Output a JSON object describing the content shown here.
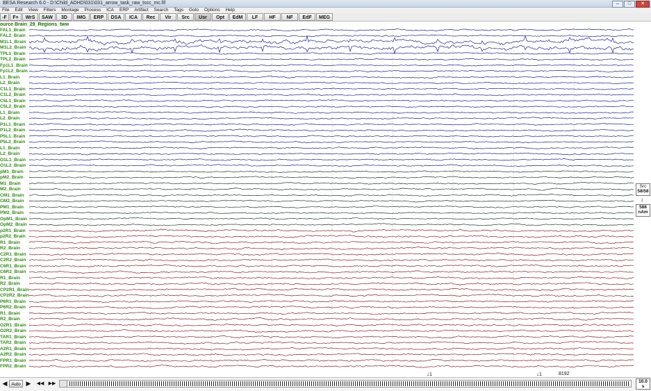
{
  "window": {
    "title": "BESA Research 6.0 - D:\\Child_ADHD\\031\\031_arrow_task_raw_tscc_mc.fif",
    "min": "–",
    "max": "□",
    "close": "✕"
  },
  "menu": [
    "File",
    "Edit",
    "View",
    "Filters",
    "Montage",
    "Process",
    "ICA",
    "ERP",
    "Artifact",
    "Search",
    "Tags",
    "Goto",
    "Options",
    "Help"
  ],
  "toolbar": [
    "-F",
    "F+",
    "WrS",
    "SAW",
    "3D",
    "IMG",
    "ERP",
    "DSA",
    "ICA",
    "Rec",
    "Vir",
    "Src",
    "Usr",
    "Opt",
    "EdM",
    "LF",
    "HF",
    "NF",
    "EdF",
    "MEG"
  ],
  "toolbar_active": "Usr",
  "montage_label": "ource Brain_29_Regions_tww",
  "channels": [
    {
      "label": "FAL1_Brain",
      "color": "#1f1f9e"
    },
    {
      "label": "FAL2_Brain",
      "color": "#1f1f9e"
    },
    {
      "label": "M1L1_Brain",
      "color": "#1f1f9e"
    },
    {
      "label": "M1L2_Brain",
      "color": "#1f1f9e"
    },
    {
      "label": "TPL1_Brain",
      "color": "#1f1f9e"
    },
    {
      "label": "TPL2_Brain",
      "color": "#1f1f9e"
    },
    {
      "label": "Fp1L1_Brain",
      "color": "#1f1f9e"
    },
    {
      "label": "Fp1L2_Brain",
      "color": "#1f1f9e"
    },
    {
      "label": "L1_Brain",
      "color": "#1f1f9e"
    },
    {
      "label": "L2_Brain",
      "color": "#1f1f9e"
    },
    {
      "label": "C1L1_Brain",
      "color": "#1f1f9e"
    },
    {
      "label": "C1L2_Brain",
      "color": "#1f1f9e"
    },
    {
      "label": "C5L1_Brain",
      "color": "#1f1f9e"
    },
    {
      "label": "C5L2_Brain",
      "color": "#1f1f9e"
    },
    {
      "label": "L1_Brain",
      "color": "#1f1f9e"
    },
    {
      "label": "L2_Brain",
      "color": "#1f1f9e"
    },
    {
      "label": "P1L1_Brain",
      "color": "#1f1f9e"
    },
    {
      "label": "P1L2_Brain",
      "color": "#1f1f9e"
    },
    {
      "label": "P5L1_Brain",
      "color": "#1f1f9e"
    },
    {
      "label": "P5L2_Brain",
      "color": "#1f1f9e"
    },
    {
      "label": "L1_Brain",
      "color": "#1f1f9e"
    },
    {
      "label": "L2_Brain",
      "color": "#1f1f9e"
    },
    {
      "label": "O1L1_Brain",
      "color": "#1f1f9e"
    },
    {
      "label": "O1L2_Brain",
      "color": "#1f1f9e"
    },
    {
      "label": "pM1_Brain",
      "color": "#1e3a2e"
    },
    {
      "label": "pM2_Brain",
      "color": "#1e3a2e"
    },
    {
      "label": "M1_Brain",
      "color": "#1e3a2e"
    },
    {
      "label": "M2_Brain",
      "color": "#1e3a2e"
    },
    {
      "label": "CM1_Brain",
      "color": "#1e3a2e"
    },
    {
      "label": "CM2_Brain",
      "color": "#1e3a2e"
    },
    {
      "label": "PM1_Brain",
      "color": "#1e3a2e"
    },
    {
      "label": "PM2_Brain",
      "color": "#1e3a2e"
    },
    {
      "label": "OpM1_Brain",
      "color": "#1e3a2e"
    },
    {
      "label": "OpM2_Brain",
      "color": "#1e3a2e"
    },
    {
      "label": "p2R1_Brain",
      "color": "#8a1f2a"
    },
    {
      "label": "p2R2_Brain",
      "color": "#8a1f2a"
    },
    {
      "label": "R1_Brain",
      "color": "#8a1f2a"
    },
    {
      "label": "R2_Brain",
      "color": "#8a1f2a"
    },
    {
      "label": "C2R1_Brain",
      "color": "#8a1f2a"
    },
    {
      "label": "C2R2_Brain",
      "color": "#8a1f2a"
    },
    {
      "label": "C6R1_Brain",
      "color": "#8a1f2a"
    },
    {
      "label": "C6R2_Brain",
      "color": "#8a1f2a"
    },
    {
      "label": "R1_Brain",
      "color": "#8a1f2a"
    },
    {
      "label": "R2_Brain",
      "color": "#8a1f2a"
    },
    {
      "label": "CP2R1_Brain",
      "color": "#8a1f2a"
    },
    {
      "label": "CP2R2_Brain",
      "color": "#8a1f2a"
    },
    {
      "label": "P6R1_Brain",
      "color": "#8a1f2a"
    },
    {
      "label": "P6R2_Brain",
      "color": "#8a1f2a"
    },
    {
      "label": "R1_Brain",
      "color": "#8a1f2a"
    },
    {
      "label": "R2_Brain",
      "color": "#8a1f2a"
    },
    {
      "label": "O2R1_Brain",
      "color": "#8a1f2a"
    },
    {
      "label": "O2R2_Brain",
      "color": "#8a1f2a"
    },
    {
      "label": "TAR1_Brain",
      "color": "#8a1f2a"
    },
    {
      "label": "TAR2_Brain",
      "color": "#8a1f2a"
    },
    {
      "label": "A2R1_Brain",
      "color": "#8a1f2a"
    },
    {
      "label": "A2R2_Brain",
      "color": "#8a1f2a"
    },
    {
      "label": "FPR1_Brain",
      "color": "#8a1f2a"
    },
    {
      "label": "FPR2_Brain",
      "color": "#8a1f2a"
    }
  ],
  "side": {
    "src_label": "Src",
    "src_count": "58/58",
    "arrow": "↕",
    "scale_value": "588",
    "scale_unit": "nAm"
  },
  "bottom": {
    "first": "◀",
    "auto": "Auto",
    "play": "▶",
    "back": "◀◀",
    "forward": "▶▶",
    "scale_top": "10.0",
    "scale_bottom": "s"
  },
  "markers": [
    {
      "text": "1"
    },
    {
      "text": "1"
    },
    {
      "text": "8192"
    }
  ],
  "colors": {
    "label_green": "#2e8b12",
    "grid": "#c8b99a"
  }
}
